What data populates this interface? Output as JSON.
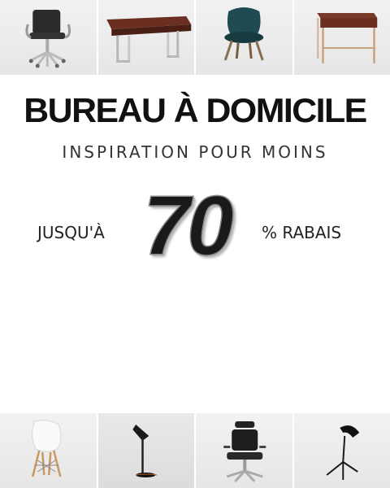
{
  "banner": {
    "headline": "BUREAU À DOMICILE",
    "subline": "INSPIRATION POUR MOINS",
    "promo_prefix": "JUSQU'À",
    "promo_value": "70",
    "promo_suffix": "% RABAIS"
  },
  "top_products": [
    {
      "icon": "office-chair-icon"
    },
    {
      "icon": "wood-desk-icon"
    },
    {
      "icon": "teal-armchair-icon"
    },
    {
      "icon": "console-table-icon"
    }
  ],
  "bottom_products": [
    {
      "icon": "white-chair-icon"
    },
    {
      "icon": "desk-lamp-icon"
    },
    {
      "icon": "ergonomic-chair-icon"
    },
    {
      "icon": "tripod-lamp-icon"
    }
  ],
  "colors": {
    "text": "#111111",
    "tile_background": "#eeeeee",
    "wood": "#6b2f22",
    "teal": "#1f4a52"
  }
}
